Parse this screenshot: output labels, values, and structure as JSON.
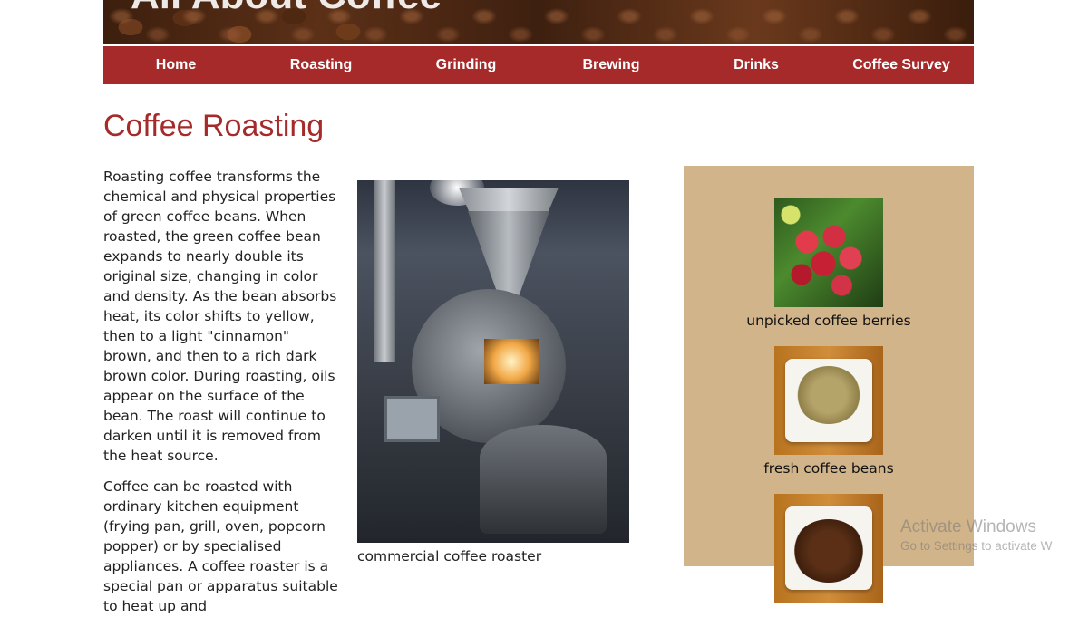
{
  "header": {
    "banner_title": "All About Coffee"
  },
  "nav": {
    "items": [
      {
        "label": "Home"
      },
      {
        "label": "Roasting"
      },
      {
        "label": "Grinding"
      },
      {
        "label": "Brewing"
      },
      {
        "label": "Drinks"
      },
      {
        "label": "Coffee Survey"
      }
    ]
  },
  "main": {
    "title": "Coffee Roasting",
    "paragraphs": [
      "Roasting coffee transforms the chemical and physical properties of green coffee beans. When roasted, the green coffee bean expands to nearly double its original size, changing in color and density. As the bean absorbs heat, its color shifts to yellow, then to a light \"cinnamon\" brown, and then to a rich dark brown color. During roasting, oils appear on the surface of the bean. The roast will continue to darken until it is removed from the heat source.",
      "Coffee can be roasted with ordinary kitchen equipment (frying pan, grill, oven, popcorn popper) or by specialised appliances. A coffee roaster is a special pan or apparatus suitable to heat up and"
    ],
    "figure_caption": "commercial coffee roaster"
  },
  "sidebar": {
    "items": [
      {
        "label": "unpicked coffee berries"
      },
      {
        "label": "fresh coffee beans"
      },
      {
        "label": ""
      }
    ]
  },
  "watermark": {
    "line1": "Activate Windows",
    "line2": "Go to Settings to activate W"
  }
}
